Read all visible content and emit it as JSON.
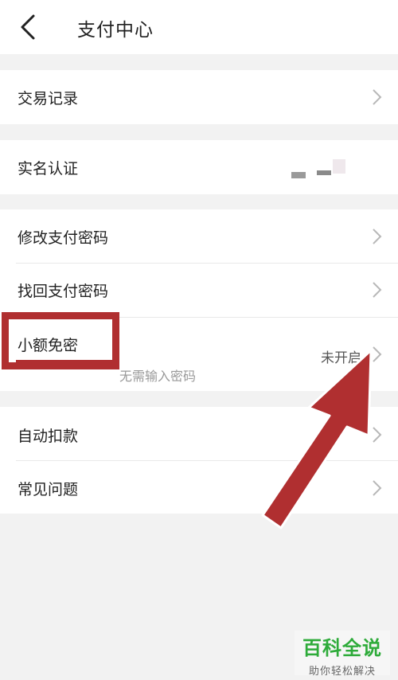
{
  "header": {
    "title": "支付中心"
  },
  "items": {
    "transactions": "交易记录",
    "realname": "实名认证",
    "change_pwd": "修改支付密码",
    "recover_pwd": "找回支付密码",
    "small_free": "小额免密",
    "small_free_value": "未开启",
    "small_free_sub": "无需输入密码",
    "auto_debit": "自动扣款",
    "faq": "常见问题"
  },
  "watermark": {
    "main": "百科全说",
    "sub": "助你轻松解决"
  },
  "colors": {
    "highlight": "#b02f30",
    "arrow": "#b02f30",
    "brand": "#2eab3a"
  },
  "icons": {
    "back": "chevron-left-icon",
    "row": "chevron-right-icon"
  }
}
